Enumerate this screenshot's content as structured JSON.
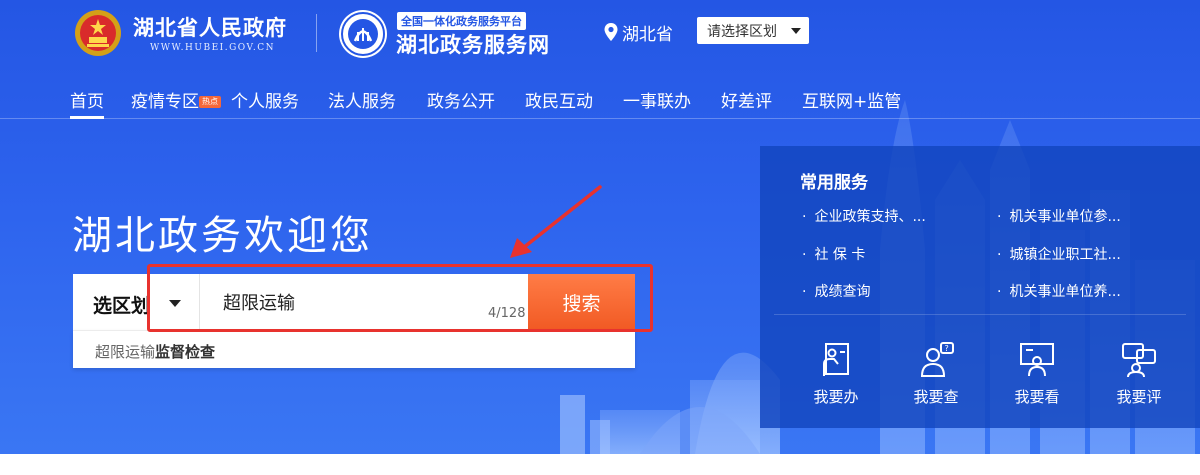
{
  "header": {
    "gov_name": "湖北省人民政府",
    "gov_url": "WWW.HUBEI.GOV.CN",
    "platform_tag": "全国一体化政务服务平台",
    "platform_name": "湖北政务服务网",
    "location": "湖北省",
    "region_select": "请选择区划"
  },
  "nav": {
    "items": [
      {
        "label": "首页"
      },
      {
        "label": "疫情专区"
      },
      {
        "label": "个人服务"
      },
      {
        "label": "法人服务"
      },
      {
        "label": "政务公开"
      },
      {
        "label": "政民互动"
      },
      {
        "label": "一事联办"
      },
      {
        "label": "好差评"
      },
      {
        "label": "互联网+监管"
      }
    ],
    "badge": "热点"
  },
  "hero": {
    "welcome": "湖北政务欢迎您"
  },
  "search": {
    "region_label": "选区划",
    "query": "超限运输",
    "count": "4/128",
    "button": "搜索",
    "suggestion_prefix": "超限运输",
    "suggestion_bold": "监督检查"
  },
  "services": {
    "title": "常用服务",
    "items": [
      {
        "label": "企业政策支持、..."
      },
      {
        "label": "机关事业单位参..."
      },
      {
        "label": "社 保 卡"
      },
      {
        "label": "城镇企业职工社..."
      },
      {
        "label": "成绩查询"
      },
      {
        "label": "机关事业单位养..."
      }
    ],
    "quick": [
      {
        "label": "我要办",
        "icon": "handle-icon"
      },
      {
        "label": "我要查",
        "icon": "inquiry-icon"
      },
      {
        "label": "我要看",
        "icon": "presentation-icon"
      },
      {
        "label": "我要评",
        "icon": "review-icon"
      }
    ]
  },
  "colors": {
    "primary_blue": "#2456e4",
    "search_orange": "#f15a24",
    "highlight_red": "#e8322e"
  }
}
